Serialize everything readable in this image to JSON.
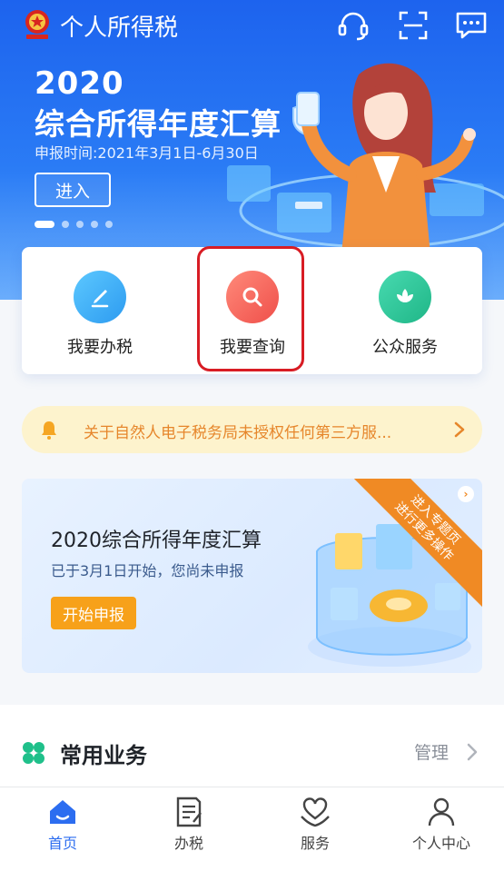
{
  "app": {
    "title": "个人所得税",
    "emblem_text": "中国税务"
  },
  "header_icons": [
    "headset-icon",
    "scan-icon",
    "message-icon"
  ],
  "banner": {
    "year": "2020",
    "title": "综合所得年度汇算",
    "shield_char": "税",
    "date_text": "申报时间:2021年3月1日-6月30日",
    "enter_label": "进入"
  },
  "quick_actions": [
    {
      "label": "我要办税",
      "icon": "pen-icon",
      "color": "#3bb0f5"
    },
    {
      "label": "我要查询",
      "icon": "magnifier-icon",
      "color": "#f2625a"
    },
    {
      "label": "公众服务",
      "icon": "lotus-icon",
      "color": "#2ac59a"
    }
  ],
  "notice": {
    "text": "关于自然人电子税务局未授权任何第三方服..."
  },
  "promo": {
    "title": "2020综合所得年度汇算",
    "subtitle": "已于3月1日开始，您尚未申报",
    "button": "开始申报",
    "ribbon": "进入专题页\n进行更多操作"
  },
  "common": {
    "title": "常用业务",
    "manage": "管理"
  },
  "bottom_nav": [
    {
      "label": "首页",
      "icon": "home-icon",
      "active": true
    },
    {
      "label": "办税",
      "icon": "document-icon",
      "active": false
    },
    {
      "label": "服务",
      "icon": "heart-hands-icon",
      "active": false
    },
    {
      "label": "个人中心",
      "icon": "person-icon",
      "active": false
    }
  ],
  "colors": {
    "brand_blue": "#2c6df0",
    "highlight_red": "#d81c24",
    "notice_orange": "#e6862b",
    "accent_orange": "#f7a11a"
  }
}
